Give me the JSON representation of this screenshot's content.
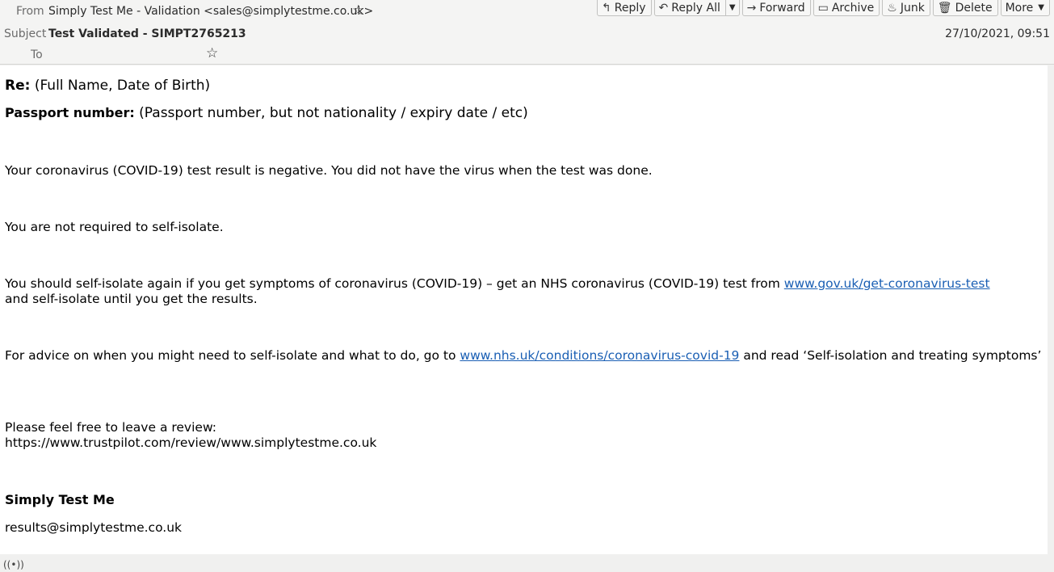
{
  "header": {
    "from_label": "From",
    "from_value": "Simply Test Me - Validation <sales@simplytestme.co.uk>",
    "subject_label": "Subject",
    "subject_value": "Test Validated - SIMPT2765213",
    "to_label": "To",
    "date": "27/10/2021, 09:51"
  },
  "toolbar": {
    "reply": "Reply",
    "reply_all": "Reply All",
    "forward": "Forward",
    "archive": "Archive",
    "junk": "Junk",
    "delete": "Delete",
    "more": "More"
  },
  "message": {
    "re_label": "Re:",
    "re_value": "(Full Name, Date of Birth)",
    "passport_label": "Passport number:",
    "passport_value": "(Passport number, but not nationality / expiry date / etc)",
    "p1": "Your coronavirus (COVID-19) test result is negative. You did not have the virus when the test was done.",
    "p2": "You are not required to self-isolate.",
    "p3_a": "You should self-isolate again if you get symptoms of coronavirus (COVID-19) – get an NHS coronavirus (COVID-19) test from ",
    "p3_link": "www.gov.uk/get-coronavirus-test",
    "p3_b": "and self-isolate until you get the results.",
    "p4_a": "For advice on when you might need to self-isolate and what to do, go to ",
    "p4_link": "www.nhs.uk/conditions/coronavirus-covid-19",
    "p4_b": " and read ‘Self-isolation and treating symptoms’",
    "p5_a": "Please feel free to leave a review:",
    "p5_b": "https://www.trustpilot.com/review/www.simplytestme.co.uk",
    "sig_name": "Simply Test Me",
    "sig_email": "results@simplytestme.co.uk"
  },
  "icons": {
    "reply": "reply-icon",
    "reply_all": "reply-all-icon",
    "forward": "forward-icon",
    "archive": "archive-icon",
    "junk": "junk-icon",
    "delete": "delete-icon",
    "status": "online-status-icon"
  }
}
